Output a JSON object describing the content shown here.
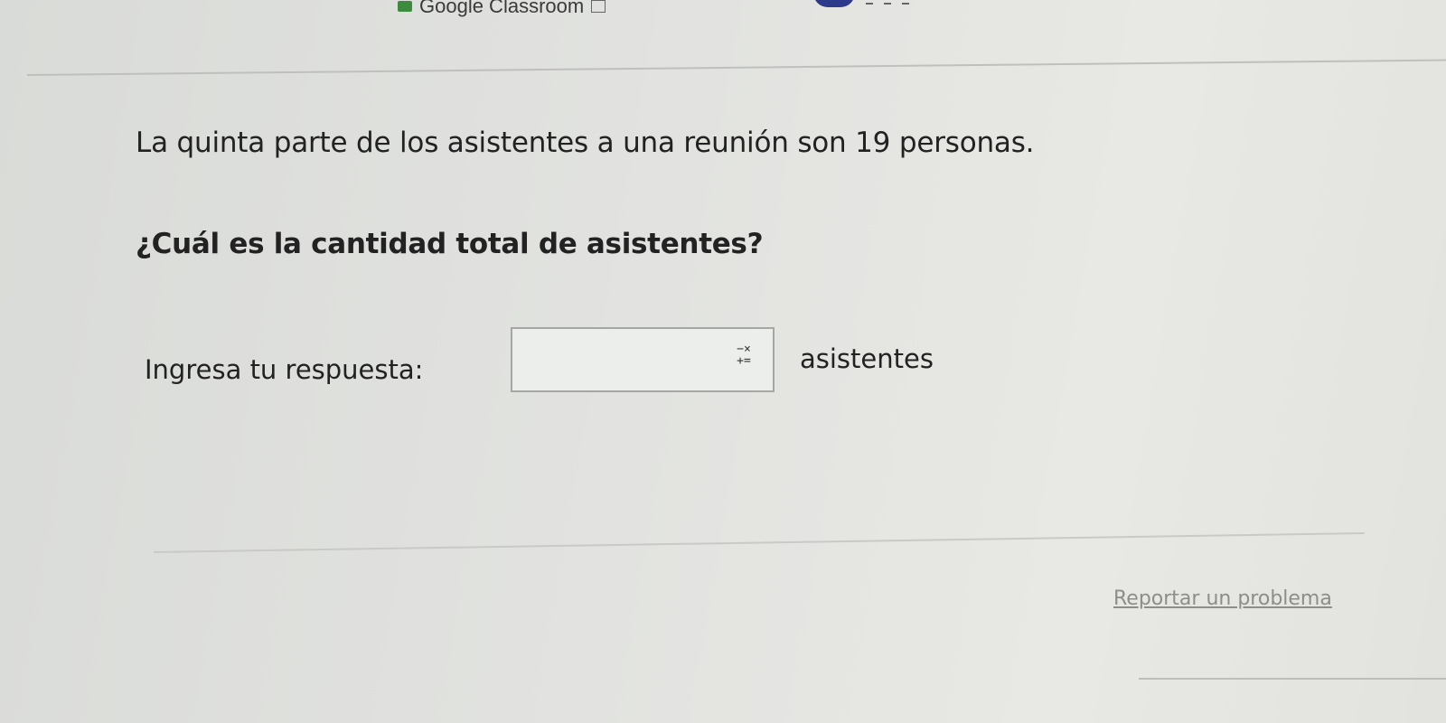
{
  "browser": {
    "tab_title": "Google Classroom",
    "logo_icon": "classroom-logo-icon",
    "frame_icon": "tab-frame-icon"
  },
  "question": {
    "statement": "La quinta parte de los asistentes a una reunión son 19 personas.",
    "prompt": "¿Cuál es la cantidad total de asistentes?"
  },
  "answer": {
    "label": "Ingresa tu respuesta:",
    "value": "",
    "placeholder": "",
    "unit": "asistentes",
    "keypad_icon": "math-keypad-icon"
  },
  "footer": {
    "report_link": "Reportar un problema"
  },
  "colors": {
    "background": "#e2e3e0",
    "text": "#222222",
    "link": "#8d8d8a",
    "input_border": "#a6a7a5"
  }
}
